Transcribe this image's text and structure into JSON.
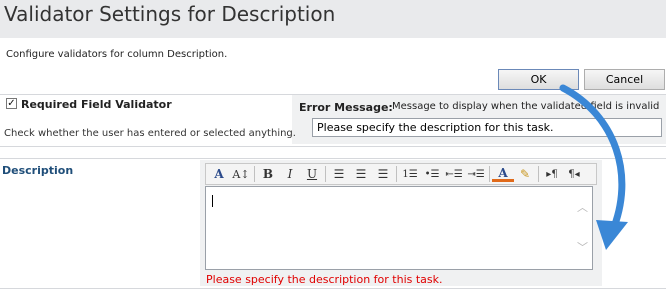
{
  "page": {
    "title": "Validator Settings for Description",
    "instructions": "Configure validators for column Description."
  },
  "buttons": {
    "ok": "OK",
    "cancel": "Cancel"
  },
  "required_validator": {
    "checked": true,
    "label": "Required Field Validator",
    "description": "Check whether the user has entered or selected anything."
  },
  "error_message": {
    "label": "Error Message:",
    "hint": "Message to display when the validated field is invalid",
    "value": "Please specify the description for this task."
  },
  "description_field": {
    "label": "Description",
    "validation_error": "Please specify the description for this task."
  },
  "toolbar": [
    {
      "icon": "font-icon",
      "glyph": "A"
    },
    {
      "icon": "font-size-icon",
      "glyph": "AÌ"
    },
    {
      "icon": "bold-icon",
      "glyph": "B"
    },
    {
      "icon": "italic-icon",
      "glyph": "I"
    },
    {
      "icon": "underline-icon",
      "glyph": "U"
    },
    {
      "icon": "align-left-icon",
      "glyph": "≡"
    },
    {
      "icon": "align-center-icon",
      "glyph": "≡"
    },
    {
      "icon": "align-right-icon",
      "glyph": "≡"
    },
    {
      "icon": "numbered-list-icon",
      "glyph": "⋮≡"
    },
    {
      "icon": "bulleted-list-icon",
      "glyph": "•≡"
    },
    {
      "icon": "decrease-indent-icon",
      "glyph": "⇤"
    },
    {
      "icon": "increase-indent-icon",
      "glyph": "⇥"
    },
    {
      "icon": "text-color-icon",
      "glyph": "A"
    },
    {
      "icon": "background-color-icon",
      "glyph": "✎"
    },
    {
      "icon": "ltr-icon",
      "glyph": "▸¶"
    },
    {
      "icon": "rtl-icon",
      "glyph": "¶◂"
    }
  ],
  "colors": {
    "title_bar": "#e9eaec",
    "section_bg": "#f0f1f2",
    "description_label": "#1f4e79",
    "error_text": "#e00000",
    "arrow": "#3a87d6"
  }
}
